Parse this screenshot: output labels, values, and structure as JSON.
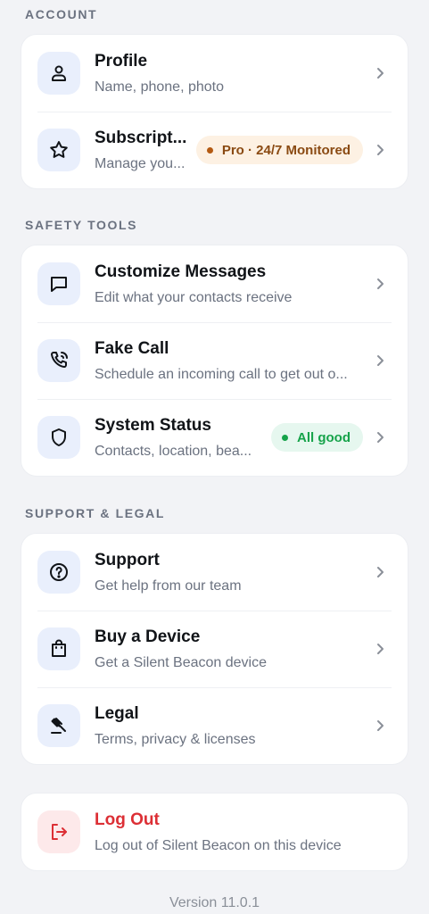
{
  "sections": {
    "account": "ACCOUNT",
    "safety_tools": "SAFETY TOOLS",
    "support_legal": "SUPPORT & LEGAL"
  },
  "account": {
    "profile": {
      "title": "Profile",
      "subtitle": "Name, phone, photo",
      "icon": "user-icon"
    },
    "subscription": {
      "title": "Subscript...",
      "subtitle": "Manage you...",
      "icon": "star-icon",
      "badge": "Pro · 24/7 Monitored"
    }
  },
  "safety": {
    "messages": {
      "title": "Customize Messages",
      "subtitle": "Edit what your contacts receive",
      "icon": "message-icon"
    },
    "fake_call": {
      "title": "Fake Call",
      "subtitle": "Schedule an incoming call to get out o...",
      "icon": "phone-call-icon"
    },
    "status": {
      "title": "System Status",
      "subtitle": "Contacts, location, bea...",
      "icon": "shield-icon",
      "badge": "All good"
    }
  },
  "support": {
    "support": {
      "title": "Support",
      "subtitle": "Get help from our team",
      "icon": "help-circle-icon"
    },
    "device": {
      "title": "Buy a Device",
      "subtitle": "Get a Silent Beacon device",
      "icon": "shopping-bag-icon"
    },
    "legal": {
      "title": "Legal",
      "subtitle": "Terms, privacy & licenses",
      "icon": "gavel-icon"
    }
  },
  "logout": {
    "title": "Log Out",
    "subtitle": "Log out of Silent Beacon on this device",
    "icon": "logout-icon"
  },
  "version": "Version 11.0.1",
  "colors": {
    "background": "#f2f3f6",
    "icon_tile": "#e9effc",
    "danger": "#dc2f35",
    "pro_badge_bg": "#fdf1e3",
    "ok_badge_bg": "#e6f7ef",
    "ok_green": "#16a34a"
  }
}
